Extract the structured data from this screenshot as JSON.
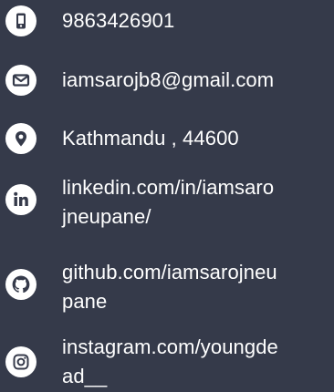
{
  "contacts": {
    "phone": {
      "text": "9863426901",
      "icon": "phone-icon"
    },
    "email": {
      "text": "iamsarojb8@gmail.com",
      "icon": "envelope-icon"
    },
    "location": {
      "text": "Kathmandu , 44600",
      "icon": "location-pin-icon"
    },
    "linkedin": {
      "line1": "linkedin.com/in/iamsaro",
      "line2": "jneupane/",
      "icon": "linkedin-icon"
    },
    "github": {
      "line1": "github.com/iamsarojneu",
      "line2": "pane",
      "icon": "github-icon"
    },
    "instagram": {
      "line1": "instagram.com/youngde",
      "line2": "ad__",
      "icon": "instagram-icon"
    }
  },
  "colors": {
    "background": "#353a4a",
    "text": "#ffffff",
    "icon_circle": "#ffffff",
    "icon_glyph": "#353a4a"
  }
}
